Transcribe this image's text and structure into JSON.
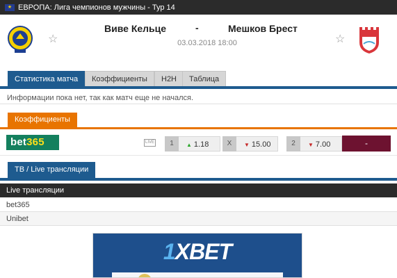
{
  "header": {
    "competition": "ЕВРОПА: Лига чемпионов мужчины - Тур 14",
    "flag_icon": "eu-flag-icon"
  },
  "match": {
    "home_team": "Виве Кельце",
    "away_team": "Мешков Брест",
    "separator": "-",
    "date": "03.03.2018 18:00",
    "home_logo_text": "KIELCE",
    "away_logo_text": "БГК"
  },
  "tabs": [
    {
      "label": "Статистика матча",
      "active": true
    },
    {
      "label": "Коэффициенты",
      "active": false
    },
    {
      "label": "H2H",
      "active": false
    },
    {
      "label": "Таблица",
      "active": false
    }
  ],
  "info_text": "Информации пока нет, так как матч еще не начался.",
  "odds_section": {
    "tab_label": "Коэффициенты",
    "bookmaker": {
      "name_main": "bet",
      "name_accent": "365"
    },
    "live_badge": "LIVE",
    "odds": [
      {
        "label": "1",
        "value": "1.18",
        "direction": "up"
      },
      {
        "label": "X",
        "value": "15.00",
        "direction": "down"
      },
      {
        "label": "2",
        "value": "7.00",
        "direction": "down"
      }
    ],
    "extra": "-"
  },
  "tv_section": {
    "tab_label": "ТВ / Live трансляции",
    "header": "Live трансляции",
    "items": [
      "bet365",
      "Unibet"
    ]
  },
  "banner": {
    "brand_number": "1",
    "brand_name": "XBET"
  },
  "colors": {
    "tab_blue": "#1e5b8f",
    "odds_orange": "#e87400",
    "bet365_green": "#14805e",
    "dark_bar": "#2b2b2b"
  }
}
